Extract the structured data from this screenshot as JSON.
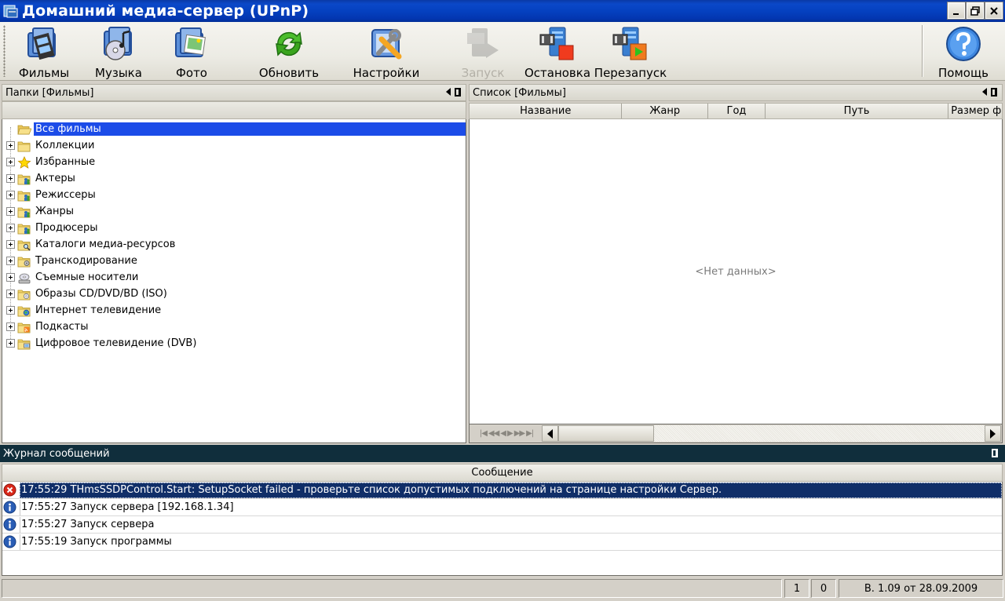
{
  "window": {
    "title": "Домашний медиа-сервер (UPnP)"
  },
  "toolbar": {
    "films": "Фильмы",
    "music": "Музыка",
    "photo": "Фото",
    "refresh": "Обновить",
    "settings": "Настройки",
    "start": "Запуск",
    "stop": "Остановка",
    "restart": "Перезапуск",
    "help": "Помощь"
  },
  "folders_panel": {
    "title": "Папки [Фильмы]",
    "items": [
      {
        "label": "Все фильмы",
        "icon": "folder-open-icon"
      },
      {
        "label": "Коллекции",
        "icon": "folder-icon"
      },
      {
        "label": "Избранные",
        "icon": "star-icon"
      },
      {
        "label": "Актеры",
        "icon": "folder-people-icon"
      },
      {
        "label": "Режиссеры",
        "icon": "folder-people-icon"
      },
      {
        "label": "Жанры",
        "icon": "folder-people-icon"
      },
      {
        "label": "Продюсеры",
        "icon": "folder-people-icon"
      },
      {
        "label": "Каталоги медиа-ресурсов",
        "icon": "folder-search-icon"
      },
      {
        "label": "Транскодирование",
        "icon": "folder-gear-icon"
      },
      {
        "label": "Съемные носители",
        "icon": "disc-drive-icon"
      },
      {
        "label": "Образы CD/DVD/BD (ISO)",
        "icon": "folder-disc-icon"
      },
      {
        "label": "Интернет телевидение",
        "icon": "folder-globe-icon"
      },
      {
        "label": "Подкасты",
        "icon": "folder-rss-icon"
      },
      {
        "label": "Цифровое телевидение (DVB)",
        "icon": "folder-tv-icon"
      }
    ]
  },
  "list_panel": {
    "title": "Список [Фильмы]",
    "columns": [
      "Название",
      "Жанр",
      "Год",
      "Путь",
      "Размер фа"
    ],
    "empty_text": "<Нет данных>"
  },
  "log_panel": {
    "title": "Журнал сообщений",
    "column": "Сообщение",
    "rows": [
      {
        "type": "error",
        "text": "17:55:29 THmsSSDPControl.Start: SetupSocket failed - проверьте список допустимых подключений на странице настройки Сервер."
      },
      {
        "type": "info",
        "text": "17:55:27 Запуск сервера [192.168.1.34]"
      },
      {
        "type": "info",
        "text": "17:55:27 Запуск сервера"
      },
      {
        "type": "info",
        "text": "17:55:19 Запуск программы"
      }
    ]
  },
  "statusbar": {
    "count1": "1",
    "count2": "0",
    "version": "В. 1.09 от 28.09.2009"
  },
  "colors": {
    "titlebar": "#0541c0",
    "selection": "#1c4ce8",
    "log_header": "#102e3c",
    "log_selection": "#102e68"
  }
}
